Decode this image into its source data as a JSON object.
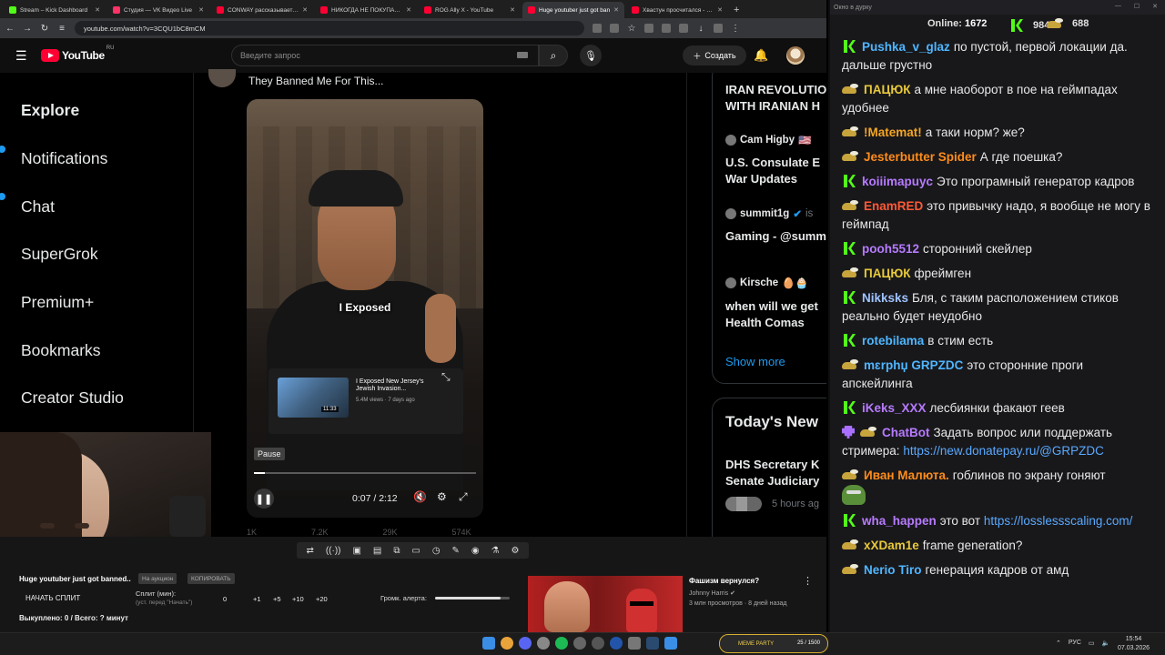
{
  "browser": {
    "tabs": [
      {
        "label": "Stream – Kick Dashboard",
        "color": "#53fc18",
        "active": false
      },
      {
        "label": "Студия — VK Видео Live",
        "color": "#ff3366",
        "active": false
      },
      {
        "label": "CONWAY рассказывает как",
        "color": "#ff0033",
        "active": false
      },
      {
        "label": "НИКОГДА НЕ ПОКУПАЙ ХЛ",
        "color": "#ff0033",
        "active": false
      },
      {
        "label": "ROG Ally X - YouTube",
        "color": "#ff0033",
        "active": false
      },
      {
        "label": "Huge youtuber just got ban",
        "color": "#ff0033",
        "active": true
      },
      {
        "label": "Хвастун просчитался - You",
        "color": "#ff0033",
        "active": false
      }
    ],
    "url": "youtube.com/watch?v=3CQU1bC8mCM"
  },
  "yt": {
    "logo_text": "YouTube",
    "region": "RU",
    "search_placeholder": "Введите запрос",
    "create_label": "Создать"
  },
  "grok_nav": [
    "Explore",
    "Notifications",
    "Chat",
    "SuperGrok",
    "Premium+",
    "Bookmarks",
    "Creator Studio"
  ],
  "post": {
    "title": "They Banned Me For This...",
    "caption": "I Exposed",
    "endcard_title": "I Exposed New Jersey's Jewish Invasion...",
    "endcard_meta": "5.4M views · 7 days ago",
    "endcard_duration": "11:33",
    "pause_tooltip": "Pause",
    "timecode": "0:07 / 2:12",
    "progress": 0.05,
    "actions": [
      "1K",
      "7.2K",
      "29K",
      "574K"
    ]
  },
  "trends": {
    "t1": "IRAN REVOLUTIO",
    "t1b": "WITH IRANIAN H",
    "u1": "Cam Higby",
    "t2": "U.S. Consulate E",
    "t2b": "War Updates",
    "u2": "summit1g",
    "u2tail": "is",
    "t3": "Gaming - @summ",
    "u3": "Kirsche",
    "t4": "when will we get",
    "t4b": "Health Comas",
    "show_more": "Show more",
    "news_header": "Today's New",
    "n1": "DHS Secretary K",
    "n1b": "Senate Judiciary",
    "n1_time": "5 hours ag"
  },
  "panel": {
    "title": "Huge youtuber just got banned..",
    "chip1": "На аукцион",
    "chip2": "КОПИРОВАТЬ",
    "start_split": "НАЧАТЬ СПЛИТ",
    "split_label": "Сплит (мин):",
    "split_hint": "(уст. перед \"Начать\")",
    "split_values": [
      "0",
      "+1",
      "+5",
      "+10",
      "+20"
    ],
    "alert_label": "Громк. алерта:",
    "alert_volume": 0.88,
    "bought": "Выкуплено: 0 / Всего: ? минут",
    "rec_title": "Фашизм вернулся?",
    "rec_channel": "Johnny Harris",
    "rec_meta": "3 млн просмотров · 8 дней назад"
  },
  "chat": {
    "window_title": "Окно в дурку",
    "online_label": "Online:",
    "online_count": "1672",
    "kick_count": "984",
    "cheer_count": "688",
    "kick_color": "#53fc18",
    "messages": [
      {
        "badge": "kick",
        "user": "Pushka_v_glaz",
        "color": "#4fb6ff",
        "text": "по пустой, первой локации да. дальше грустно"
      },
      {
        "badge": "sub",
        "user": "ПАЦЮК",
        "color": "#e8c93a",
        "text": "а мне наоборот в пое на геймпадах удобнее"
      },
      {
        "badge": "sub",
        "user": "!Matemat!",
        "color": "#f5a623",
        "text": "а таки норм? же?"
      },
      {
        "badge": "sub",
        "user": "Jesterbutter Spider",
        "color": "#ff8c1a",
        "text": "А где поешка?"
      },
      {
        "badge": "kick",
        "user": "koiiimapuyc",
        "color": "#b77bff",
        "text": "Это програмный генератор кадров"
      },
      {
        "badge": "sub",
        "user": "EnamRED",
        "color": "#ff5a36",
        "text": "это привычку надо, я вообще не могу в геймпад"
      },
      {
        "badge": "kick",
        "user": "pooh5512",
        "color": "#b77bff",
        "text": "сторонний скейлер"
      },
      {
        "badge": "sub",
        "user": "ПАЦЮК",
        "color": "#e8c93a",
        "text": "фреймген"
      },
      {
        "badge": "kick",
        "user": "Nikksks",
        "color": "#9fc3ff",
        "text": "Бля, с таким расположением стиков реально будет неудобно"
      },
      {
        "badge": "kick",
        "user": "rotebilama",
        "color": "#4fb6ff",
        "text": "в стим есть"
      },
      {
        "badge": "sub",
        "user": "mɛrphџ  GRPZDC",
        "color": "#4fb6ff",
        "text": "это сторонние проги апскейлинга"
      },
      {
        "badge": "kick",
        "user": "iKeks_XXX",
        "color": "#b77bff",
        "text": "лесбиянки факают геев"
      },
      {
        "badge": "bot",
        "user": "ChatBot",
        "color": "#b77bff",
        "text": "Задать вопрос или поддержать стримера:",
        "link": "https://new.donatepay.ru/@GRPZDC"
      },
      {
        "badge": "sub",
        "user": "Иван Малюта.",
        "color": "#ff8c1a",
        "text": "гоблинов по экрану гоняют",
        "emote": true
      },
      {
        "badge": "kick",
        "user": "wha_happen",
        "color": "#b77bff",
        "text": "это вот",
        "link": "https://losslessscaling.com/"
      },
      {
        "badge": "sub",
        "user": "xXDam1e",
        "color": "#e8c93a",
        "text": "frame generation?"
      },
      {
        "badge": "sub",
        "user": "Nerio Tiro",
        "color": "#4fb6ff",
        "text": "генерация кадров от амд"
      }
    ]
  },
  "taskbar": {
    "meme_label": "MEME PARTY",
    "meme_count": "25 / 1500",
    "lang": "РУС",
    "time": "15:54",
    "date": "07.03.2026"
  }
}
